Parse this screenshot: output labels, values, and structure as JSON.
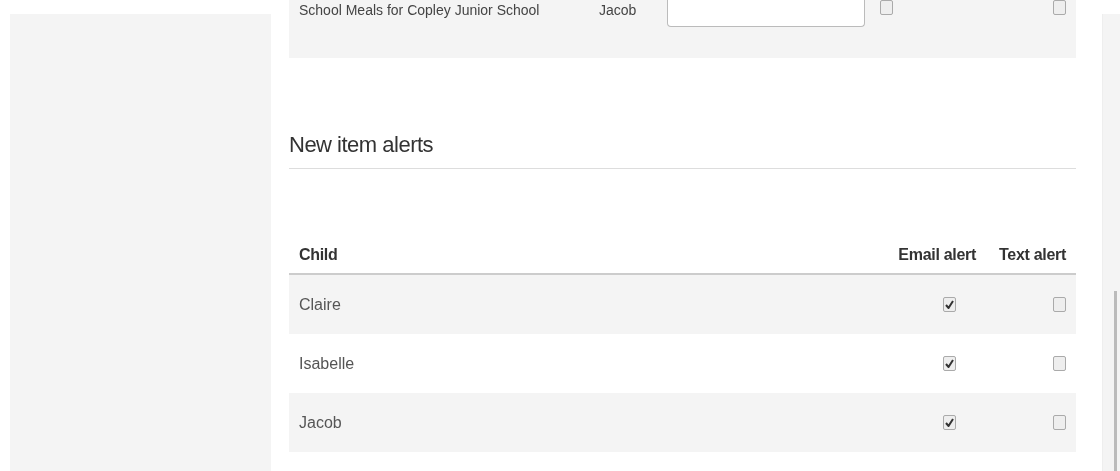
{
  "previous_section": {
    "rows": [
      {
        "item": "School Meals for Copley Junior School",
        "child": "Jacob",
        "email_alert": false,
        "text_alert": false
      }
    ]
  },
  "new_item_alerts": {
    "title": "New item alerts",
    "columns": [
      "Child",
      "Email alert",
      "Text alert"
    ],
    "rows": [
      {
        "child": "Claire",
        "email_alert": true,
        "text_alert": false
      },
      {
        "child": "Isabelle",
        "email_alert": true,
        "text_alert": false
      },
      {
        "child": "Jacob",
        "email_alert": true,
        "text_alert": false
      }
    ]
  }
}
